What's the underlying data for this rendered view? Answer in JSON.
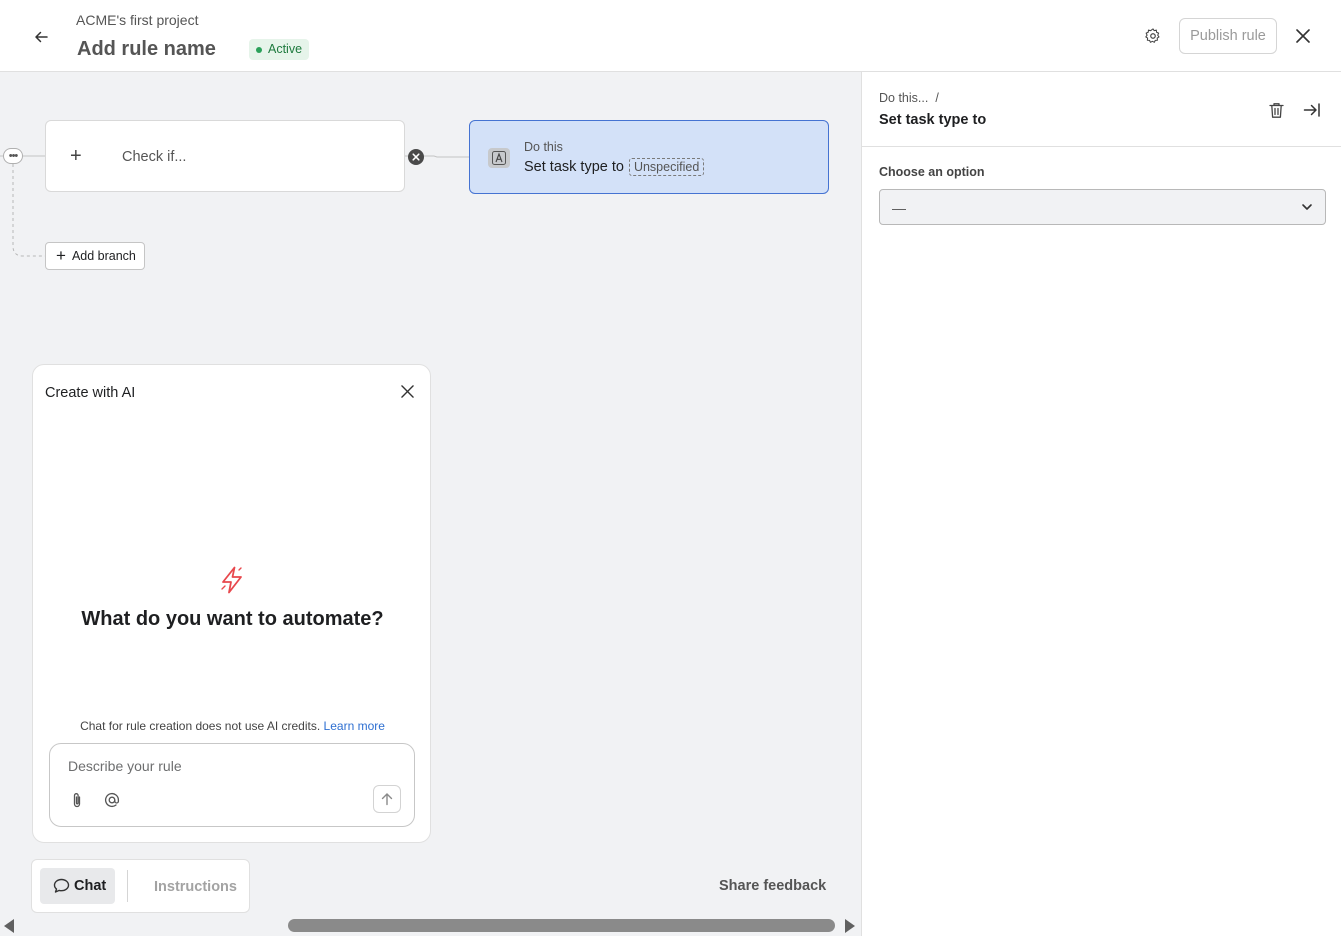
{
  "header": {
    "project_name": "ACME's first project",
    "rule_name": "Add rule name",
    "status": "Active",
    "publish_label": "Publish rule",
    "icons": [
      "back-arrow-icon",
      "gear-icon",
      "close-icon"
    ]
  },
  "canvas": {
    "trigger": {
      "label": "Check if..."
    },
    "action": {
      "kicker": "Do this",
      "text": "Set task type to",
      "chip": "Unspecified",
      "icon": "text-field-icon"
    },
    "add_branch_label": "Add branch"
  },
  "ai_panel": {
    "title": "Create with AI",
    "question": "What do you want to automate?",
    "note": "Chat for rule creation does not use AI credits.",
    "learn_more": "Learn more",
    "input_placeholder": "Describe your rule",
    "bolt_color": "#e8484d"
  },
  "toolbar": {
    "chat_label": "Chat",
    "instructions_label": "Instructions",
    "share_feedback": "Share feedback"
  },
  "side_panel": {
    "breadcrumb": "Do this...",
    "breadcrumb_sep": "/",
    "title": "Set task type to",
    "option_label": "Choose an option",
    "option_value": "—"
  },
  "colors": {
    "action_bg": "#d3e1f8",
    "action_border": "#4573d2",
    "status_green": "#2aa15a",
    "canvas_bg": "#f1f2f4"
  }
}
